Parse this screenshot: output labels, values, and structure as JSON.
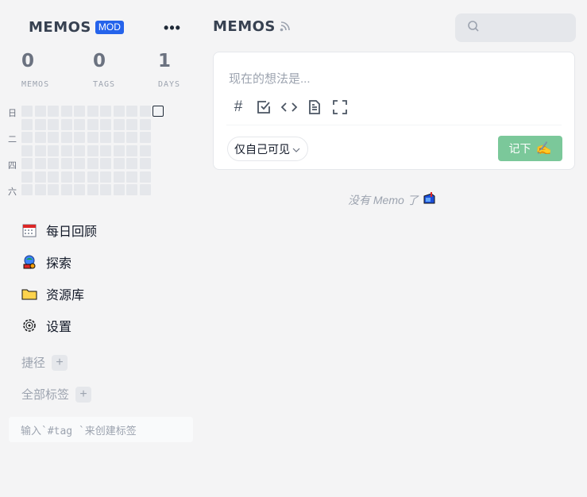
{
  "sidebar": {
    "brand": "MEMOS",
    "badge": "MOD",
    "more": "•••",
    "stats": [
      {
        "value": "0",
        "label": "MEMOS"
      },
      {
        "value": "0",
        "label": "TAGS"
      },
      {
        "value": "1",
        "label": "DAYS"
      }
    ],
    "weekdays": {
      "sun": "日",
      "tue": "二",
      "thu": "四",
      "sat": "六"
    },
    "nav": [
      {
        "label": "每日回顾",
        "icon": "calendar-icon"
      },
      {
        "label": "探索",
        "icon": "explore-icon"
      },
      {
        "label": "资源库",
        "icon": "folder-icon"
      },
      {
        "label": "设置",
        "icon": "gear-icon"
      }
    ],
    "shortcuts_label": "捷径",
    "all_tags_label": "全部标签",
    "plus": "+",
    "tag_hint": "输入`#tag `来创建标签"
  },
  "main": {
    "title": "MEMOS",
    "search": {
      "placeholder": ""
    },
    "editor": {
      "placeholder": "现在的想法是...",
      "tools": [
        "tag-icon",
        "checkbox-icon",
        "code-icon",
        "file-icon",
        "fullscreen-icon"
      ],
      "hash": "#",
      "visibility": "仅自己可见",
      "save_label": "记下",
      "save_emoji": "✍️"
    },
    "empty_text": "没有 Memo 了",
    "empty_emoji": "📬"
  },
  "colors": {
    "accent_badge": "#2563eb",
    "save_button": "#7bc89a",
    "background": "#f4f4f5"
  }
}
